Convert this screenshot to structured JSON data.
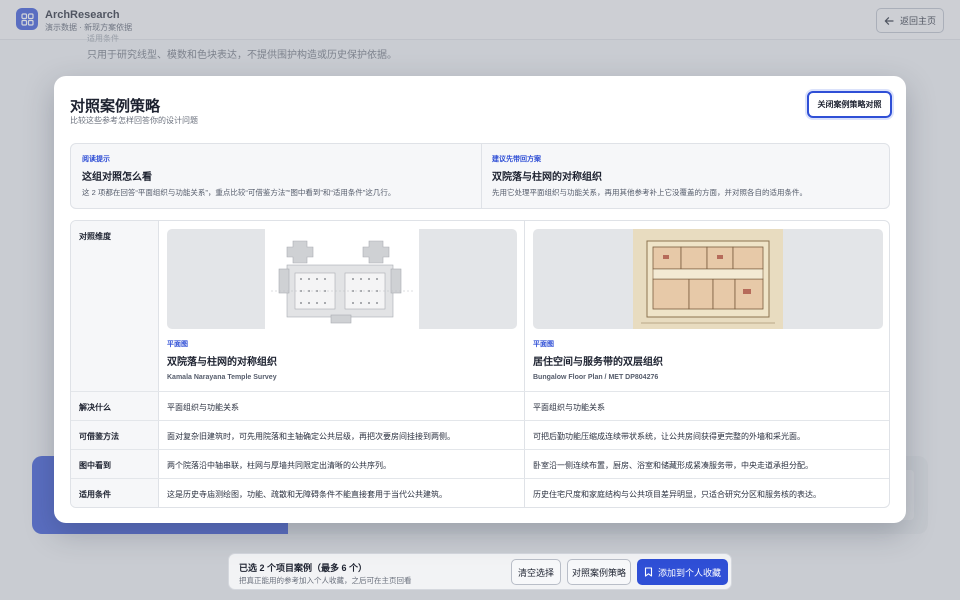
{
  "app": {
    "brand_title": "ArchResearch",
    "brand_subtitle": "演示数据 · 新现方案依据",
    "home_button": "返回主页",
    "background_note": "只用于研究线型、模数和色块表达，不提供围护构造或历史保护依据。",
    "background_note_top": "适用条件"
  },
  "selection_bar": {
    "title": "已选 2 个项目案例（最多 6 个）",
    "subtitle": "把真正能用的参考加入个人收藏，之后可在主页回看",
    "clear_button": "清空选择",
    "compare_button": "对照案例策略",
    "save_button": "添加到个人收藏"
  },
  "modal": {
    "title": "对照案例策略",
    "subtitle": "比较这些参考怎样回答你的设计问题",
    "close_button": "关闭案例策略对照",
    "hint_left": {
      "kicker": "阅读提示",
      "heading": "这组对照怎么看",
      "text": "这 2 项都在回答“平面组织与功能关系”，重点比较“可借鉴方法”“图中看到”和“适用条件”这几行。"
    },
    "hint_right": {
      "kicker": "建议先带回方案",
      "heading": "双院落与柱网的对称组织",
      "text": "先用它处理平面组织与功能关系，再用其他参考补上它没覆盖的方面，并对照各自的适用条件。"
    },
    "dimension_header": "对照维度",
    "cases": [
      {
        "kicker": "平面图",
        "title": "双院落与柱网的对称组织",
        "source": "Kamala Narayana Temple Survey"
      },
      {
        "kicker": "平面图",
        "title": "居住空间与服务带的双层组织",
        "source": "Bungalow Floor Plan / MET DP804276"
      }
    ],
    "rows": [
      {
        "label": "解决什么",
        "a": "平面组织与功能关系",
        "b": "平面组织与功能关系"
      },
      {
        "label": "可借鉴方法",
        "a": "面对复杂旧建筑时，可先用院落和主轴确定公共层级，再把次要房间挂接到两侧。",
        "b": "可把后勤功能压缩成连续带状系统，让公共房间获得更完整的外墙和采光面。"
      },
      {
        "label": "图中看到",
        "a": "两个院落沿中轴串联，柱网与厚墙共同限定出清晰的公共序列。",
        "b": "卧室沿一侧连续布置，厨房、浴室和储藏形成紧凑服务带，中央走道承担分配。"
      },
      {
        "label": "适用条件",
        "a": "这是历史寺庙测绘图，功能、疏散和无障碍条件不能直接套用于当代公共建筑。",
        "b": "历史住宅尺度和家庭结构与公共项目差异明显，只适合研究分区和服务核的表达。"
      }
    ]
  },
  "colors": {
    "accent": "#2f4fd6",
    "text": "#1d2230",
    "muted": "#6b717d",
    "paper": "#e8dcc0"
  },
  "icons": {
    "logo": "grid-apps-icon",
    "back": "arrow-left-icon",
    "bookmark": "bookmark-icon"
  }
}
